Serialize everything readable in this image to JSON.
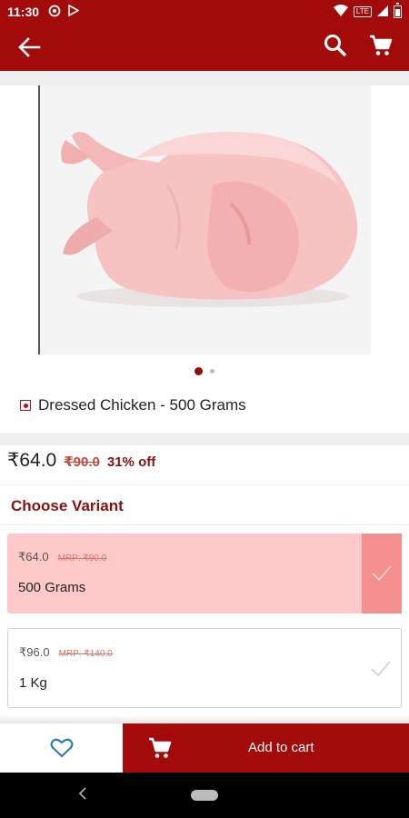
{
  "status_bar": {
    "time": "11:30",
    "icons": [
      "notification-icon",
      "play-store-icon"
    ],
    "network_label": "LTE"
  },
  "app_bar": {
    "icons": [
      "back-arrow-icon",
      "search-icon",
      "cart-icon"
    ]
  },
  "gallery": {
    "image_subject": "whole dressed chicken",
    "pages": 2,
    "active_page": 1
  },
  "product": {
    "title": "Dressed Chicken - 500 Grams",
    "price": "₹64.0",
    "mrp": "₹90.0",
    "discount": "31% off"
  },
  "variants": {
    "heading": "Choose Variant",
    "items": [
      {
        "price": "₹64.0",
        "mrp": "MRP: ₹90.0",
        "name": "500 Grams",
        "selected": true
      },
      {
        "price": "₹96.0",
        "mrp": "MRP: ₹140.0",
        "name": "1 Kg",
        "selected": false
      }
    ]
  },
  "bottom_bar": {
    "add_to_cart_label": "Add to cart"
  },
  "colors": {
    "primary": "#a30a0a",
    "selected_card": "#ffc9c9",
    "selected_check": "#f48f8f",
    "accent_text": "#8b0f0f"
  }
}
